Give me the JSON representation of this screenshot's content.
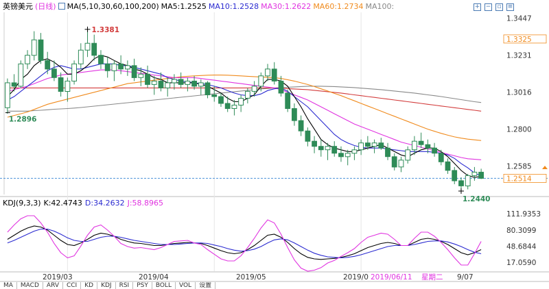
{
  "header": {
    "instrument": "英镑美元",
    "period": "(日线)",
    "ma_label": "MA(5,10,30,60,100,200)",
    "ma5": "MA5:1.2525",
    "ma10": "MA10:1.2528",
    "ma30": "MA30:1.2622",
    "ma60": "MA60:1.2734",
    "ma100": "MA100:"
  },
  "kdj_header": {
    "label": "KDJ(9,3,3)",
    "k": "K:42.4743",
    "d": "D:34.2632",
    "j": "J:58.8965"
  },
  "price_axis": {
    "ticks": [
      "1.3447",
      "1.3325",
      "1.3231",
      "1.3016",
      "1.2800",
      "1.2585",
      "1.2514"
    ]
  },
  "kdj_axis": {
    "ticks": [
      "111.9353",
      "80.3099",
      "48.6844",
      "17.0590"
    ]
  },
  "x_axis": {
    "labels": [
      "2019/03",
      "2019/04",
      "2019/05",
      "2019/0",
      "2019/06/11",
      "星期二",
      "9/07"
    ]
  },
  "annotations": {
    "high": "1.3381",
    "low": "1.2440",
    "left_low": "1.2896"
  },
  "tabs": [
    "MA",
    "MACD",
    "ARV",
    "CCI",
    "KD",
    "KDJ",
    "RSI",
    "PSY",
    "BOLL",
    "VOL",
    "设置"
  ],
  "colors": {
    "up": "#2e8b57",
    "down": "#2e8b57",
    "ma5": "#000000",
    "ma10": "#2a2ad0",
    "ma30": "#e033e0",
    "ma60": "#f08a1c",
    "ma100": "#d23a3a",
    "ma200": "#888888",
    "k": "#000000",
    "d": "#2a2ad0",
    "j": "#e033e0",
    "current": "#f08a1c"
  },
  "chart_data": [
    {
      "type": "candlestick",
      "title": "英镑美元 (日线)",
      "candles": [
        [
          1.2925,
          1.3095,
          1.289,
          1.307
        ],
        [
          1.307,
          1.312,
          1.302,
          1.305
        ],
        [
          1.305,
          1.32,
          1.304,
          1.318
        ],
        [
          1.318,
          1.326,
          1.315,
          1.323
        ],
        [
          1.323,
          1.337,
          1.32,
          1.332
        ],
        [
          1.332,
          1.336,
          1.318,
          1.32
        ],
        [
          1.32,
          1.325,
          1.312,
          1.315
        ],
        [
          1.315,
          1.32,
          1.308,
          1.31
        ],
        [
          1.31,
          1.313,
          1.299,
          1.302
        ],
        [
          1.302,
          1.31,
          1.296,
          1.308
        ],
        [
          1.308,
          1.32,
          1.306,
          1.318
        ],
        [
          1.318,
          1.33,
          1.315,
          1.326
        ],
        [
          1.326,
          1.3381,
          1.322,
          1.33
        ],
        [
          1.33,
          1.335,
          1.32,
          1.323
        ],
        [
          1.323,
          1.326,
          1.315,
          1.318
        ],
        [
          1.318,
          1.322,
          1.31,
          1.314
        ],
        [
          1.314,
          1.32,
          1.308,
          1.318
        ],
        [
          1.318,
          1.323,
          1.312,
          1.315
        ],
        [
          1.315,
          1.32,
          1.311,
          1.317
        ],
        [
          1.317,
          1.321,
          1.308,
          1.31
        ],
        [
          1.31,
          1.316,
          1.305,
          1.312
        ],
        [
          1.312,
          1.317,
          1.304,
          1.306
        ],
        [
          1.306,
          1.311,
          1.3,
          1.308
        ],
        [
          1.308,
          1.313,
          1.302,
          1.304
        ],
        [
          1.304,
          1.31,
          1.299,
          1.307
        ],
        [
          1.307,
          1.312,
          1.303,
          1.309
        ],
        [
          1.309,
          1.313,
          1.304,
          1.306
        ],
        [
          1.306,
          1.31,
          1.302,
          1.308
        ],
        [
          1.308,
          1.311,
          1.303,
          1.305
        ],
        [
          1.305,
          1.309,
          1.3,
          1.307
        ],
        [
          1.307,
          1.308,
          1.298,
          1.3
        ],
        [
          1.3,
          1.305,
          1.296,
          1.299
        ],
        [
          1.299,
          1.301,
          1.293,
          1.295
        ],
        [
          1.295,
          1.299,
          1.29,
          1.292
        ],
        [
          1.292,
          1.297,
          1.288,
          1.294
        ],
        [
          1.294,
          1.3,
          1.29,
          1.298
        ],
        [
          1.298,
          1.304,
          1.295,
          1.302
        ],
        [
          1.302,
          1.308,
          1.299,
          1.305
        ],
        [
          1.305,
          1.313,
          1.302,
          1.311
        ],
        [
          1.311,
          1.318,
          1.308,
          1.315
        ],
        [
          1.315,
          1.319,
          1.306,
          1.308
        ],
        [
          1.308,
          1.311,
          1.299,
          1.301
        ],
        [
          1.301,
          1.303,
          1.29,
          1.292
        ],
        [
          1.292,
          1.295,
          1.282,
          1.285
        ],
        [
          1.285,
          1.288,
          1.276,
          1.279
        ],
        [
          1.279,
          1.281,
          1.27,
          1.273
        ],
        [
          1.273,
          1.276,
          1.266,
          1.27
        ],
        [
          1.27,
          1.274,
          1.264,
          1.268
        ],
        [
          1.268,
          1.272,
          1.262,
          1.27
        ],
        [
          1.27,
          1.273,
          1.264,
          1.266
        ],
        [
          1.266,
          1.27,
          1.261,
          1.264
        ],
        [
          1.264,
          1.268,
          1.259,
          1.266
        ],
        [
          1.266,
          1.27,
          1.262,
          1.268
        ],
        [
          1.268,
          1.274,
          1.265,
          1.272
        ],
        [
          1.272,
          1.276,
          1.268,
          1.27
        ],
        [
          1.27,
          1.274,
          1.266,
          1.272
        ],
        [
          1.272,
          1.275,
          1.268,
          1.269
        ],
        [
          1.269,
          1.272,
          1.262,
          1.264
        ],
        [
          1.264,
          1.266,
          1.256,
          1.258
        ],
        [
          1.258,
          1.264,
          1.255,
          1.262
        ],
        [
          1.262,
          1.27,
          1.26,
          1.268
        ],
        [
          1.268,
          1.276,
          1.265,
          1.273
        ],
        [
          1.273,
          1.278,
          1.269,
          1.271
        ],
        [
          1.271,
          1.274,
          1.266,
          1.269
        ],
        [
          1.269,
          1.272,
          1.264,
          1.266
        ],
        [
          1.266,
          1.268,
          1.259,
          1.261
        ],
        [
          1.261,
          1.263,
          1.254,
          1.256
        ],
        [
          1.256,
          1.258,
          1.248,
          1.25
        ],
        [
          1.25,
          1.252,
          1.244,
          1.247
        ],
        [
          1.247,
          1.254,
          1.245,
          1.253
        ],
        [
          1.253,
          1.258,
          1.25,
          1.255
        ],
        [
          1.255,
          1.257,
          1.251,
          1.2514
        ]
      ],
      "ma_series": {
        "ma5": [
          1.299,
          1.303,
          1.309,
          1.312,
          1.317,
          1.32,
          1.321,
          1.319,
          1.316,
          1.312,
          1.312,
          1.314,
          1.317,
          1.321,
          1.323,
          1.322,
          1.32,
          1.318,
          1.317,
          1.315,
          1.314,
          1.312,
          1.31,
          1.309,
          1.307,
          1.307,
          1.307,
          1.307,
          1.307,
          1.306,
          1.305,
          1.303,
          1.301,
          1.298,
          1.296,
          1.296,
          1.298,
          1.3,
          1.305,
          1.309,
          1.309,
          1.308,
          1.305,
          1.299,
          1.293,
          1.286,
          1.28,
          1.274,
          1.271,
          1.269,
          1.268,
          1.267,
          1.267,
          1.268,
          1.269,
          1.27,
          1.271,
          1.269,
          1.267,
          1.265,
          1.264,
          1.266,
          1.268,
          1.269,
          1.269,
          1.267,
          1.264,
          1.26,
          1.256,
          1.253,
          1.252,
          1.2525
        ],
        "ma10": [
          1.297,
          1.299,
          1.302,
          1.305,
          1.308,
          1.311,
          1.314,
          1.316,
          1.317,
          1.316,
          1.315,
          1.315,
          1.316,
          1.317,
          1.318,
          1.318,
          1.318,
          1.317,
          1.317,
          1.316,
          1.315,
          1.314,
          1.313,
          1.312,
          1.31,
          1.309,
          1.308,
          1.3075,
          1.307,
          1.3065,
          1.306,
          1.305,
          1.304,
          1.3025,
          1.301,
          1.3,
          1.2995,
          1.2995,
          1.3005,
          1.3025,
          1.3035,
          1.304,
          1.302,
          1.299,
          1.296,
          1.293,
          1.289,
          1.285,
          1.281,
          1.277,
          1.274,
          1.272,
          1.2705,
          1.2695,
          1.269,
          1.269,
          1.269,
          1.2685,
          1.268,
          1.2675,
          1.267,
          1.267,
          1.267,
          1.267,
          1.2665,
          1.266,
          1.265,
          1.263,
          1.26,
          1.2575,
          1.2545,
          1.2528
        ],
        "ma30": [
          1.302,
          1.303,
          1.304,
          1.305,
          1.3065,
          1.308,
          1.3095,
          1.3105,
          1.3115,
          1.312,
          1.3125,
          1.313,
          1.3135,
          1.314,
          1.3145,
          1.3145,
          1.3145,
          1.314,
          1.3135,
          1.313,
          1.3125,
          1.312,
          1.3115,
          1.311,
          1.3105,
          1.31,
          1.31,
          1.31,
          1.31,
          1.3095,
          1.309,
          1.3085,
          1.308,
          1.3075,
          1.307,
          1.3065,
          1.306,
          1.3055,
          1.305,
          1.3045,
          1.304,
          1.303,
          1.3015,
          1.3,
          1.2985,
          1.297,
          1.295,
          1.293,
          1.291,
          1.289,
          1.287,
          1.285,
          1.283,
          1.2815,
          1.28,
          1.2785,
          1.277,
          1.2755,
          1.274,
          1.2725,
          1.2715,
          1.2705,
          1.2695,
          1.2685,
          1.2675,
          1.2665,
          1.2655,
          1.2645,
          1.2635,
          1.2628,
          1.2625,
          1.2622
        ],
        "ma60": [
          1.287,
          1.288,
          1.289,
          1.29,
          1.2915,
          1.293,
          1.2945,
          1.2955,
          1.2965,
          1.2975,
          1.2985,
          1.2995,
          1.3005,
          1.3015,
          1.3025,
          1.3035,
          1.3045,
          1.3055,
          1.3065,
          1.307,
          1.3075,
          1.308,
          1.3085,
          1.309,
          1.3095,
          1.31,
          1.3105,
          1.3108,
          1.311,
          1.3112,
          1.3114,
          1.3115,
          1.3115,
          1.3114,
          1.3112,
          1.311,
          1.3108,
          1.3106,
          1.3104,
          1.3102,
          1.31,
          1.3095,
          1.3088,
          1.308,
          1.307,
          1.306,
          1.3048,
          1.3035,
          1.3022,
          1.3008,
          1.2995,
          1.298,
          1.2965,
          1.295,
          1.2935,
          1.292,
          1.2905,
          1.289,
          1.2875,
          1.286,
          1.2845,
          1.283,
          1.2815,
          1.28,
          1.2788,
          1.2776,
          1.2765,
          1.2755,
          1.2748,
          1.2742,
          1.2738,
          1.2734
        ],
        "ma100": [
          1.304,
          1.304,
          1.304,
          1.304,
          1.304,
          1.304,
          1.304,
          1.304,
          1.304,
          1.304,
          1.304,
          1.304,
          1.304,
          1.304,
          1.304,
          1.304,
          1.304,
          1.304,
          1.304,
          1.304,
          1.304,
          1.304,
          1.304,
          1.304,
          1.304,
          1.304,
          1.304,
          1.304,
          1.304,
          1.304,
          1.304,
          1.304,
          1.304,
          1.304,
          1.304,
          1.304,
          1.304,
          1.304,
          1.304,
          1.304,
          1.304,
          1.3038,
          1.3036,
          1.3034,
          1.3032,
          1.303,
          1.3026,
          1.3022,
          1.3018,
          1.3014,
          1.301,
          1.3005,
          1.3,
          1.2995,
          1.299,
          1.2985,
          1.298,
          1.2975,
          1.297,
          1.2965,
          1.296,
          1.2955,
          1.295,
          1.2945,
          1.294,
          1.2935,
          1.293,
          1.2925,
          1.292,
          1.2915,
          1.291,
          1.2905
        ],
        "ma200": [
          1.2905,
          1.2905,
          1.2905,
          1.2905,
          1.2908,
          1.291,
          1.2913,
          1.2916,
          1.2918,
          1.292,
          1.2923,
          1.2926,
          1.293,
          1.2934,
          1.2938,
          1.2942,
          1.2946,
          1.295,
          1.2954,
          1.2958,
          1.2962,
          1.2966,
          1.297,
          1.2974,
          1.2978,
          1.2982,
          1.2986,
          1.299,
          1.2994,
          1.2998,
          1.3002,
          1.3006,
          1.301,
          1.3014,
          1.3018,
          1.3022,
          1.3026,
          1.303,
          1.3034,
          1.3037,
          1.304,
          1.3042,
          1.3044,
          1.3046,
          1.3048,
          1.305,
          1.305,
          1.305,
          1.3049,
          1.3048,
          1.3046,
          1.3044,
          1.3042,
          1.3039,
          1.3036,
          1.3033,
          1.303,
          1.3026,
          1.3022,
          1.3018,
          1.3014,
          1.301,
          1.3005,
          1.3,
          1.2995,
          1.299,
          1.2984,
          1.2978,
          1.2972,
          1.2966,
          1.296,
          1.2955
        ]
      },
      "ylim": [
        1.242,
        1.348
      ],
      "current_price": 1.2514
    },
    {
      "type": "line",
      "title": "KDJ(9,3,3)",
      "series": [
        {
          "name": "K",
          "values": [
            62,
            70,
            78,
            84,
            88,
            86,
            80,
            70,
            60,
            52,
            50,
            55,
            62,
            70,
            74,
            72,
            68,
            62,
            58,
            55,
            54,
            52,
            50,
            50,
            52,
            54,
            55,
            56,
            55,
            54,
            50,
            45,
            40,
            36,
            34,
            36,
            42,
            50,
            60,
            70,
            72,
            66,
            56,
            44,
            34,
            27,
            24,
            23,
            24,
            25,
            27,
            30,
            34,
            40,
            46,
            50,
            54,
            56,
            54,
            50,
            50,
            56,
            62,
            64,
            62,
            58,
            52,
            44,
            36,
            32,
            36,
            42
          ]
        },
        {
          "name": "D",
          "values": [
            55,
            60,
            66,
            72,
            78,
            82,
            82,
            78,
            72,
            65,
            60,
            58,
            58,
            62,
            66,
            68,
            68,
            66,
            63,
            60,
            58,
            56,
            54,
            52,
            52,
            52,
            53,
            54,
            55,
            55,
            54,
            51,
            48,
            44,
            41,
            39,
            40,
            43,
            48,
            55,
            61,
            63,
            61,
            55,
            48,
            41,
            35,
            31,
            28,
            27,
            26,
            27,
            29,
            32,
            36,
            40,
            44,
            48,
            50,
            50,
            50,
            52,
            55,
            58,
            59,
            59,
            57,
            53,
            48,
            42,
            37,
            34
          ]
        },
        {
          "name": "J",
          "values": [
            76,
            90,
            102,
            108,
            108,
            94,
            76,
            54,
            36,
            26,
            30,
            49,
            70,
            86,
            90,
            80,
            68,
            54,
            48,
            45,
            46,
            44,
            42,
            46,
            52,
            58,
            59,
            60,
            55,
            52,
            42,
            33,
            24,
            20,
            20,
            30,
            46,
            64,
            84,
            100,
            94,
            72,
            46,
            22,
            6,
            0,
            2,
            7,
            16,
            21,
            29,
            36,
            44,
            56,
            66,
            70,
            74,
            72,
            62,
            50,
            50,
            64,
            76,
            76,
            68,
            56,
            42,
            26,
            12,
            12,
            34,
            58
          ]
        }
      ],
      "ylim": [
        0,
        120
      ]
    }
  ]
}
